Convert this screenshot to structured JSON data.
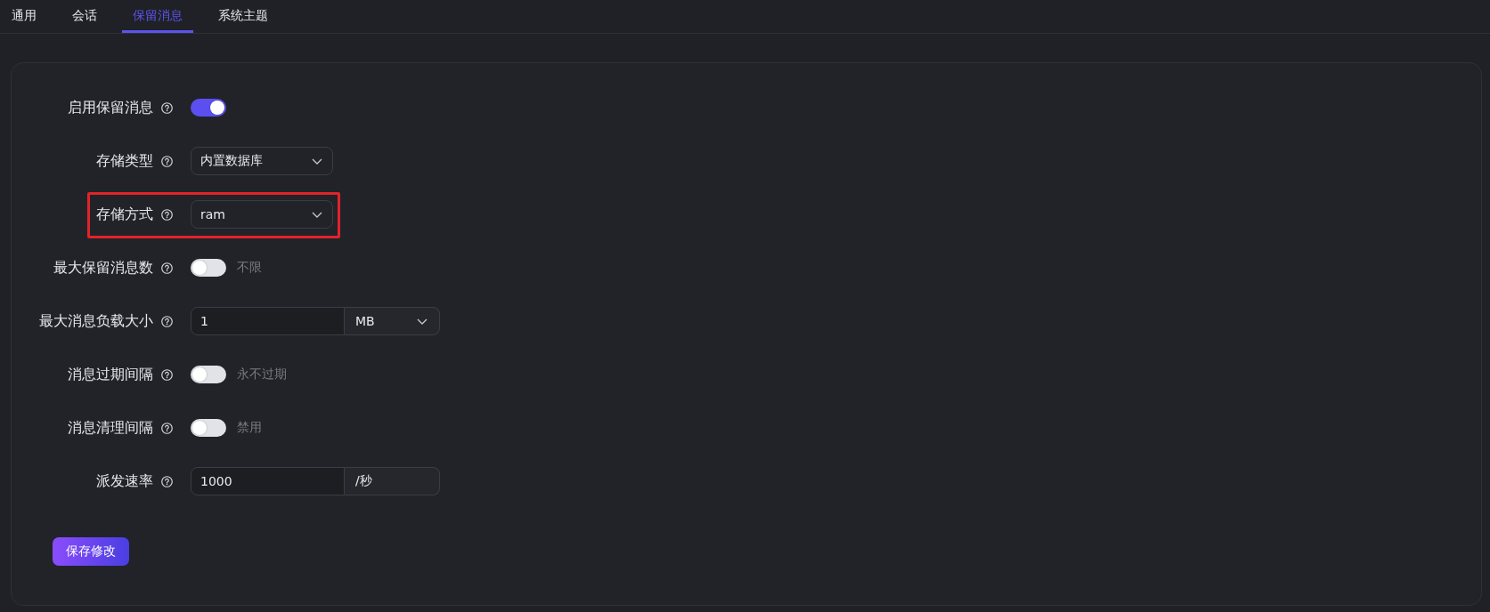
{
  "tabs": [
    {
      "label": "通用",
      "selected": false
    },
    {
      "label": "会话",
      "selected": false
    },
    {
      "label": "保留消息",
      "selected": true
    },
    {
      "label": "系统主题",
      "selected": false
    }
  ],
  "form": {
    "fields": [
      {
        "kind": "switch",
        "label": "启用保留消息",
        "on": true,
        "highlighted": false
      },
      {
        "kind": "select",
        "label": "存储类型",
        "value": "内置数据库",
        "highlighted": false
      },
      {
        "kind": "select",
        "label": "存储方式",
        "value": "ram",
        "highlighted": true
      },
      {
        "kind": "switch",
        "label": "最大保留消息数",
        "on": false,
        "note": "不限",
        "highlighted": false
      },
      {
        "kind": "input_select",
        "label": "最大消息负载大小",
        "value": "1",
        "unit": "MB",
        "highlighted": false
      },
      {
        "kind": "switch",
        "label": "消息过期间隔",
        "on": false,
        "note": "永不过期",
        "highlighted": false
      },
      {
        "kind": "switch",
        "label": "消息清理间隔",
        "on": false,
        "note": "禁用",
        "highlighted": false
      },
      {
        "kind": "input_suffix",
        "label": "派发速率",
        "value": "1000",
        "suffix": "/秒",
        "highlighted": false
      }
    ],
    "save_button": {
      "label": "保存修改"
    }
  }
}
